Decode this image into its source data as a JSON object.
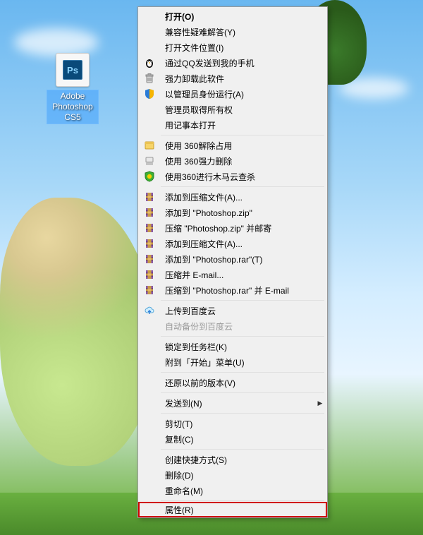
{
  "desktop": {
    "icon_label": "Adobe Photoshop CS5",
    "icon_glyph": "Ps"
  },
  "menu": {
    "items": [
      {
        "label": "打开(O)",
        "icon": "none",
        "bold": true
      },
      {
        "label": "兼容性疑难解答(Y)",
        "icon": "none"
      },
      {
        "label": "打开文件位置(I)",
        "icon": "none"
      },
      {
        "label": "通过QQ发送到我的手机",
        "icon": "qq-penguin-icon"
      },
      {
        "label": "强力卸载此软件",
        "icon": "trash-icon"
      },
      {
        "label": "以管理员身份运行(A)",
        "icon": "shield-icon"
      },
      {
        "label": "管理员取得所有权",
        "icon": "none"
      },
      {
        "label": "用记事本打开",
        "icon": "none"
      },
      {
        "sep": true
      },
      {
        "label": "使用 360解除占用",
        "icon": "360-unlock-icon"
      },
      {
        "label": "使用 360强力删除",
        "icon": "360-shred-icon"
      },
      {
        "label": "使用360进行木马云查杀",
        "icon": "360-shield-icon"
      },
      {
        "sep": true
      },
      {
        "label": "添加到压缩文件(A)...",
        "icon": "winrar-icon"
      },
      {
        "label": "添加到 \"Photoshop.zip\"",
        "icon": "winrar-icon"
      },
      {
        "label": "压缩 \"Photoshop.zip\" 并邮寄",
        "icon": "winrar-icon"
      },
      {
        "label": "添加到压缩文件(A)...",
        "icon": "winrar-icon"
      },
      {
        "label": "添加到 \"Photoshop.rar\"(T)",
        "icon": "winrar-icon"
      },
      {
        "label": "压缩并 E-mail...",
        "icon": "winrar-icon"
      },
      {
        "label": "压缩到 \"Photoshop.rar\" 并 E-mail",
        "icon": "winrar-icon"
      },
      {
        "sep": true
      },
      {
        "label": "上传到百度云",
        "icon": "baidu-cloud-icon"
      },
      {
        "label": "自动备份到百度云",
        "icon": "none",
        "disabled": true
      },
      {
        "sep": true
      },
      {
        "label": "锁定到任务栏(K)",
        "icon": "none"
      },
      {
        "label": "附到「开始」菜单(U)",
        "icon": "none"
      },
      {
        "sep": true
      },
      {
        "label": "还原以前的版本(V)",
        "icon": "none"
      },
      {
        "sep": true
      },
      {
        "label": "发送到(N)",
        "icon": "none",
        "submenu": true
      },
      {
        "sep": true
      },
      {
        "label": "剪切(T)",
        "icon": "none"
      },
      {
        "label": "复制(C)",
        "icon": "none"
      },
      {
        "sep": true
      },
      {
        "label": "创建快捷方式(S)",
        "icon": "none"
      },
      {
        "label": "删除(D)",
        "icon": "none"
      },
      {
        "label": "重命名(M)",
        "icon": "none"
      },
      {
        "sep": true
      },
      {
        "label": "属性(R)",
        "icon": "none",
        "highlight": true
      }
    ]
  }
}
